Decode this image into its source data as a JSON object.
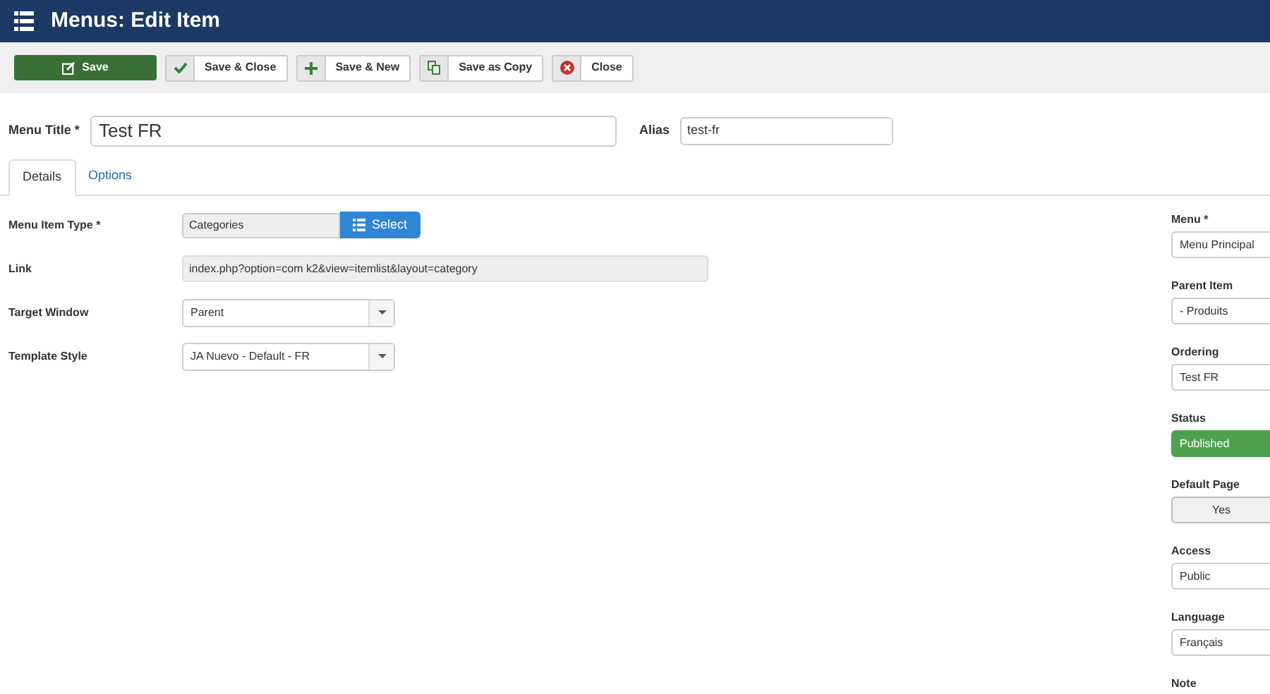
{
  "header": {
    "title": "Menus: Edit Item"
  },
  "toolbar": [
    {
      "label": "Save",
      "kind": "save"
    },
    {
      "label": "Save & Close",
      "kind": "check"
    },
    {
      "label": "Save & New",
      "kind": "plus"
    },
    {
      "label": "Save as Copy",
      "kind": "copy"
    },
    {
      "label": "Close",
      "kind": "close"
    }
  ],
  "title_field": {
    "label": "Menu Title *",
    "value": "Test FR"
  },
  "alias_field": {
    "label": "Alias",
    "value": "test-fr"
  },
  "tabs": [
    {
      "label": "Details",
      "selected": true
    },
    {
      "label": "Options",
      "selected": false
    }
  ],
  "details": [
    {
      "label": "Menu Item Type *",
      "kind": "type",
      "value": "Categories",
      "button": "Select"
    },
    {
      "label": "Link",
      "kind": "readonly",
      "value": "index.php?option=com  k2&view=itemlist&layout=category"
    },
    {
      "label": "Target Window",
      "kind": "select",
      "value": "Parent"
    },
    {
      "label": "Template Style",
      "kind": "select",
      "value": "JA  Nuevo - Default - FR"
    }
  ],
  "sidebar": [
    {
      "label": "Menu *",
      "kind": "select",
      "value": "Menu Principal"
    },
    {
      "label": "Parent Item",
      "kind": "select",
      "value": "- Produits"
    },
    {
      "label": "Ordering",
      "kind": "select",
      "value": "Test FR"
    },
    {
      "label": "Status",
      "kind": "status",
      "value": "Published"
    },
    {
      "label": "Default Page",
      "kind": "toggle",
      "value": "Yes"
    },
    {
      "label": "Access",
      "kind": "select",
      "value": "Public"
    },
    {
      "label": "Language",
      "kind": "select",
      "value": "Français"
    },
    {
      "label": "Note",
      "kind": "label"
    }
  ]
}
